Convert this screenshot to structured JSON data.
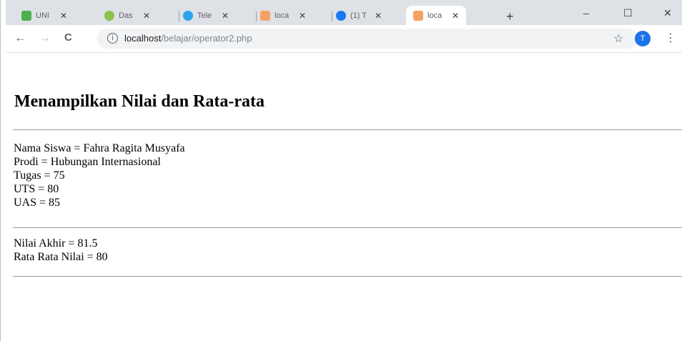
{
  "tabs": [
    {
      "title": "UNI",
      "color": "#4caf50",
      "active": false
    },
    {
      "title": "Das",
      "color": "#8bc34a",
      "active": false
    },
    {
      "title": "Tele",
      "color": "#2aa3ef",
      "active": false
    },
    {
      "title": "loca",
      "color": "#f4a261",
      "active": false
    },
    {
      "title": "(1) T",
      "color": "#1877f2",
      "active": false
    },
    {
      "title": "loca",
      "color": "#f4a261",
      "active": true
    }
  ],
  "new_tab_label": "+",
  "window_controls": {
    "minimize": "–",
    "maximize": "☐",
    "close": "✕"
  },
  "toolbar": {
    "back": "←",
    "forward": "→",
    "reload": "C",
    "url_host": "localhost",
    "url_path": "/belajar/operator2.php",
    "star": "☆",
    "avatar_letter": "T",
    "menu": "⋮"
  },
  "page": {
    "heading": "Menampilkan Nilai dan Rata-rata",
    "student_lines": [
      "Nama Siswa = Fahra Ragita Musyafa",
      "Prodi = Hubungan Internasional",
      "Tugas = 75",
      "UTS = 80",
      "UAS = 85"
    ],
    "result_lines": [
      "Nilai Akhir = 81.5",
      "Rata Rata Nilai = 80"
    ]
  }
}
